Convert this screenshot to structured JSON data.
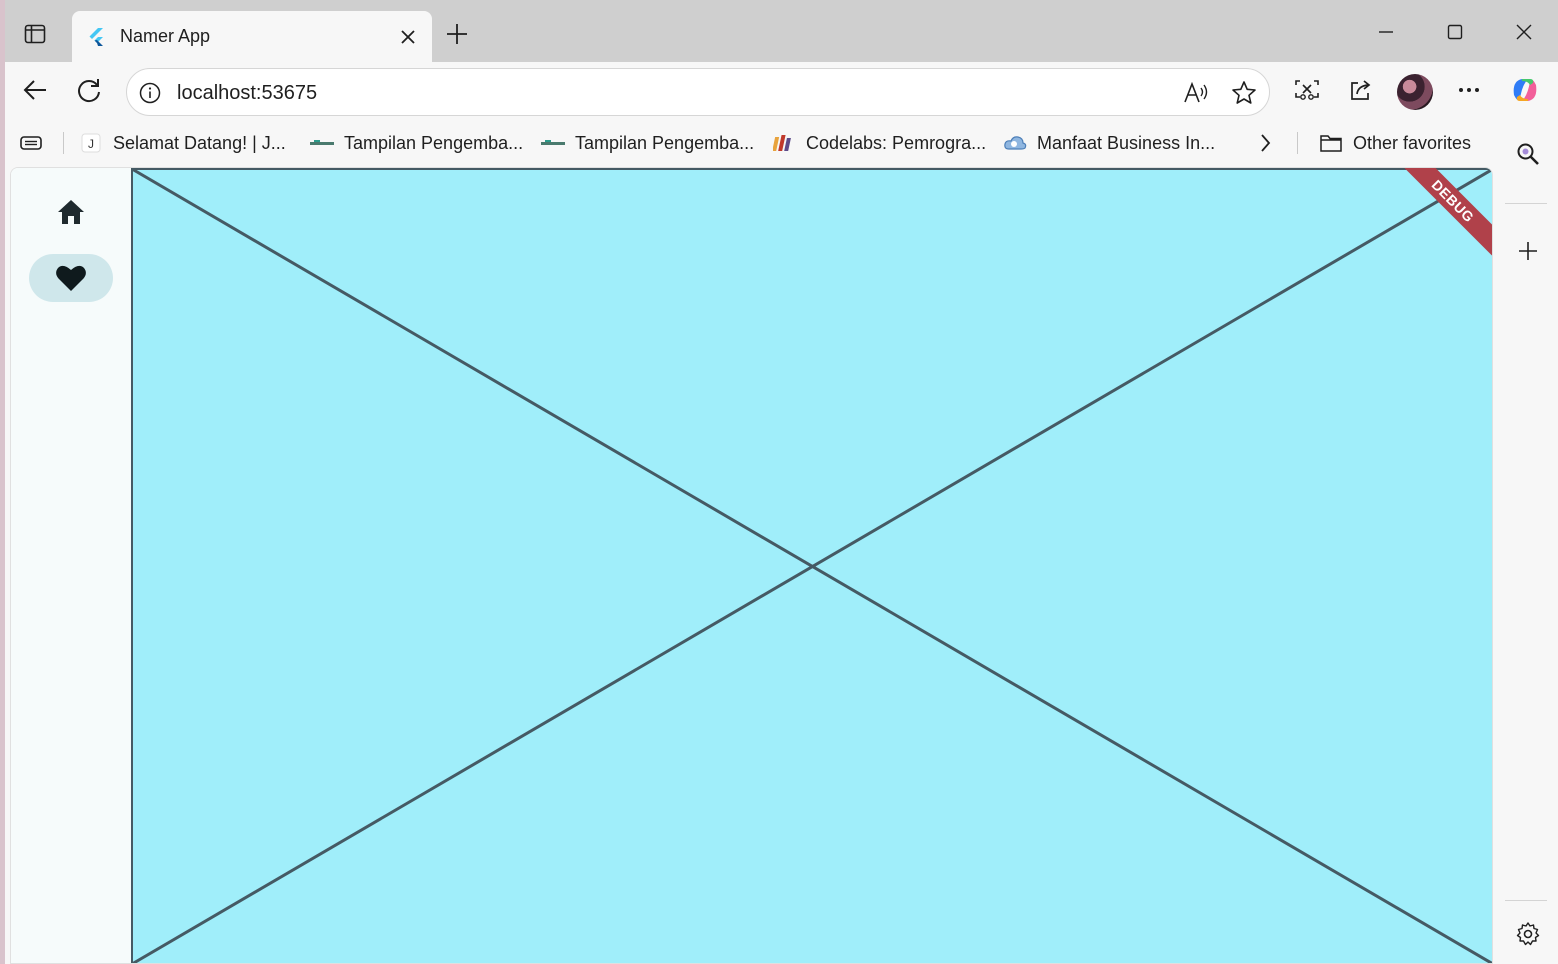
{
  "browser": {
    "tab": {
      "title": "Namer App",
      "favicon": "flutter-logo-icon"
    },
    "address": {
      "url": "localhost:53675"
    },
    "favorites": [
      {
        "label": "Selamat Datang! | J...",
        "icon": "letter-j-icon"
      },
      {
        "label": "Tampilan Pengemba...",
        "icon": "site-logo-icon"
      },
      {
        "label": "Tampilan Pengemba...",
        "icon": "site-logo-icon"
      },
      {
        "label": "Codelabs: Pemrogra...",
        "icon": "codelabs-icon"
      },
      {
        "label": "Manfaat Business In...",
        "icon": "cloud-icon"
      }
    ],
    "other_favorites": "Other favorites"
  },
  "app": {
    "rail": [
      {
        "name": "Home",
        "icon": "home-icon",
        "selected": false
      },
      {
        "name": "Favorites",
        "icon": "heart-icon",
        "selected": true
      }
    ],
    "debug_banner": "DEBUG",
    "canvas_color": "#a0eefa"
  }
}
